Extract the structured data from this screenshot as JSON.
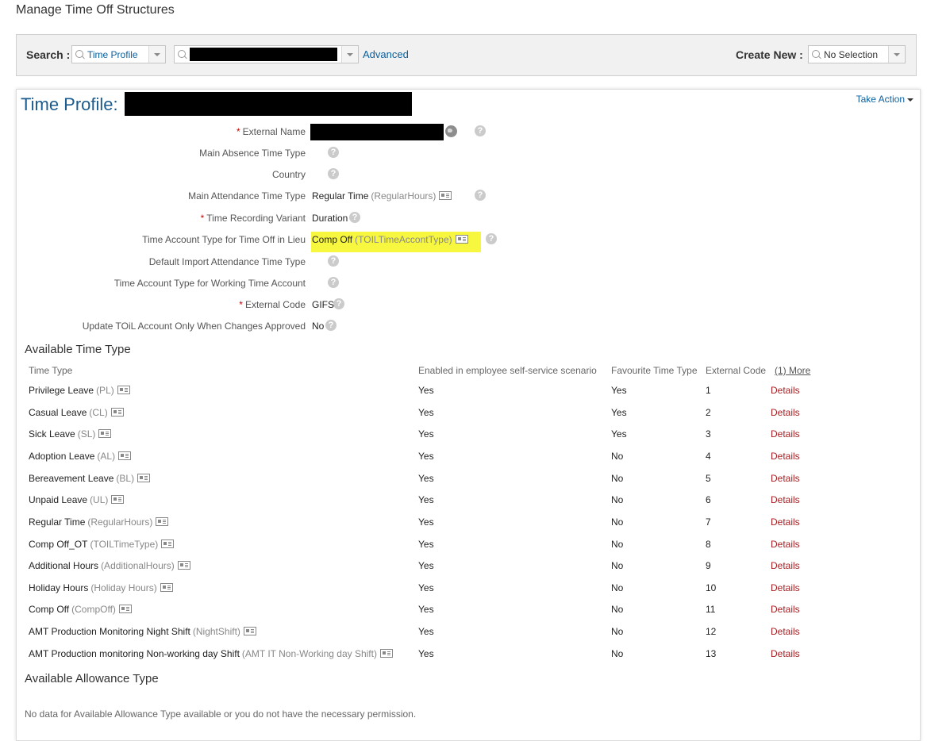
{
  "page": {
    "title": "Manage Time Off Structures"
  },
  "search": {
    "label": "Search :",
    "type_value": "Time Profile",
    "advanced_label": "Advanced",
    "create_new_label": "Create New :",
    "create_new_value": "No Selection"
  },
  "profile": {
    "label": "Time Profile:",
    "take_action_label": "Take Action",
    "highlight_color": "#f7f740",
    "fields": [
      {
        "label": "External Name",
        "required": true,
        "value": "",
        "code": ""
      },
      {
        "label": "Main Absence Time Type",
        "required": false,
        "value": "",
        "code": ""
      },
      {
        "label": "Country",
        "required": false,
        "value": "",
        "code": ""
      },
      {
        "label": "Main Attendance Time Type",
        "required": false,
        "value": "Regular Time",
        "code": "(RegularHours)"
      },
      {
        "label": "Time Recording Variant",
        "required": true,
        "value": "Duration",
        "code": ""
      },
      {
        "label": "Time Account Type for Time Off in Lieu",
        "required": false,
        "value": "Comp Off",
        "code": "(TOILTimeAccontType)"
      },
      {
        "label": "Default Import Attendance Time Type",
        "required": false,
        "value": "",
        "code": ""
      },
      {
        "label": "Time Account Type for Working Time Account",
        "required": false,
        "value": "",
        "code": ""
      },
      {
        "label": "External Code",
        "required": true,
        "value": "GIFS",
        "code": ""
      },
      {
        "label": "Update TOiL Account Only When Changes Approved",
        "required": false,
        "value": "No",
        "code": ""
      }
    ]
  },
  "time_types": {
    "title": "Available Time Type",
    "headers": {
      "time_type": "Time Type",
      "enabled": "Enabled in employee self-service scenario",
      "favourite": "Favourite Time Type",
      "external_code": "External Code",
      "more": "(1) More"
    },
    "details_label": "Details",
    "rows": [
      {
        "name": "Privilege Leave",
        "code": "(PL)",
        "enabled": "Yes",
        "favourite": "Yes",
        "ext": "1"
      },
      {
        "name": "Casual Leave",
        "code": "(CL)",
        "enabled": "Yes",
        "favourite": "Yes",
        "ext": "2"
      },
      {
        "name": "Sick Leave",
        "code": "(SL)",
        "enabled": "Yes",
        "favourite": "Yes",
        "ext": "3"
      },
      {
        "name": "Adoption Leave",
        "code": "(AL)",
        "enabled": "Yes",
        "favourite": "No",
        "ext": "4"
      },
      {
        "name": "Bereavement Leave",
        "code": "(BL)",
        "enabled": "Yes",
        "favourite": "No",
        "ext": "5"
      },
      {
        "name": "Unpaid Leave",
        "code": "(UL)",
        "enabled": "Yes",
        "favourite": "No",
        "ext": "6"
      },
      {
        "name": "Regular Time",
        "code": "(RegularHours)",
        "enabled": "Yes",
        "favourite": "No",
        "ext": "7"
      },
      {
        "name": "Comp Off_OT",
        "code": "(TOILTimeType)",
        "enabled": "Yes",
        "favourite": "No",
        "ext": "8"
      },
      {
        "name": "Additional Hours",
        "code": "(AdditionalHours)",
        "enabled": "Yes",
        "favourite": "No",
        "ext": "9"
      },
      {
        "name": "Holiday Hours",
        "code": "(Holiday Hours)",
        "enabled": "Yes",
        "favourite": "No",
        "ext": "10"
      },
      {
        "name": "Comp Off",
        "code": "(CompOff)",
        "enabled": "Yes",
        "favourite": "No",
        "ext": "11"
      },
      {
        "name": "AMT Production Monitoring Night Shift",
        "code": "(NightShift)",
        "enabled": "Yes",
        "favourite": "No",
        "ext": "12"
      },
      {
        "name": "AMT Production monitoring Non-working day Shift",
        "code": "(AMT IT Non-Working day Shift)",
        "enabled": "Yes",
        "favourite": "No",
        "ext": "13"
      }
    ]
  },
  "allowance": {
    "title": "Available Allowance Type",
    "no_data": "No data for Available Allowance Type available or you do not have the necessary permission."
  }
}
